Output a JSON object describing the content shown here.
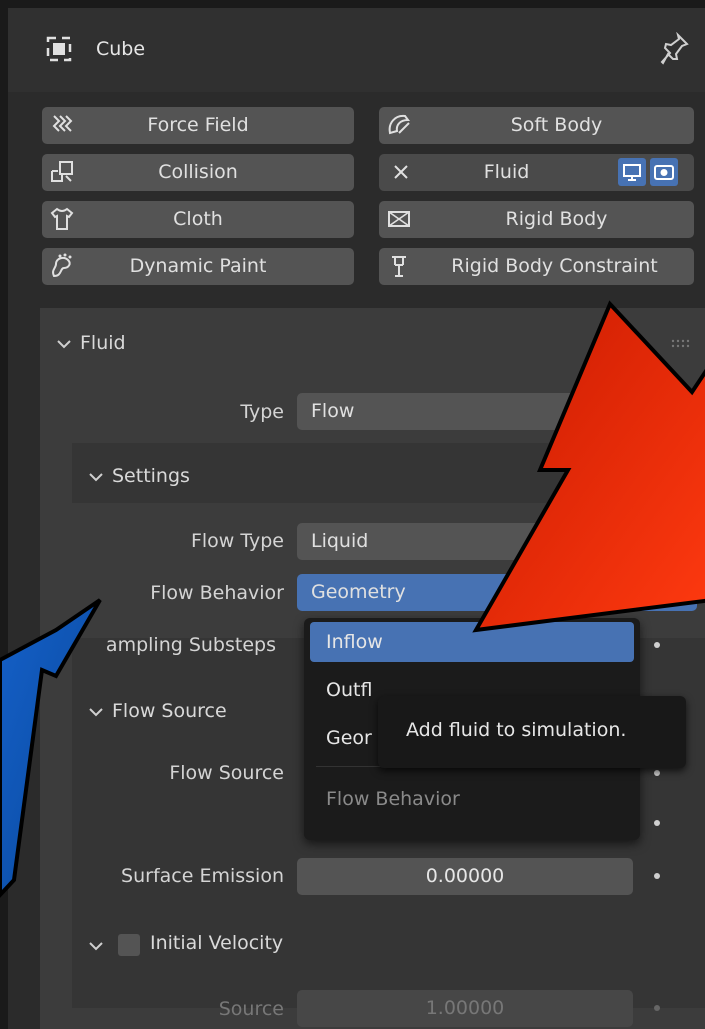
{
  "header": {
    "object_name": "Cube"
  },
  "physics_buttons": {
    "force_field": "Force Field",
    "soft_body": "Soft Body",
    "collision": "Collision",
    "fluid": "Fluid",
    "cloth": "Cloth",
    "rigid_body": "Rigid Body",
    "dynamic_paint": "Dynamic Paint",
    "rigid_body_constraint": "Rigid Body Constraint"
  },
  "fluid_panel": {
    "title": "Fluid",
    "type_label": "Type",
    "type_value": "Flow",
    "settings": {
      "title": "Settings",
      "flow_type_label": "Flow Type",
      "flow_type_value": "Liquid",
      "flow_behavior_label": "Flow Behavior",
      "flow_behavior_value": "Geometry",
      "sampling_label": "ampling Substeps"
    },
    "flow_source": {
      "title": "Flow Source",
      "flow_source_label": "Flow Source",
      "surface_emission_label": "Surface Emission",
      "surface_emission_value": "0.00000"
    },
    "initial_velocity": {
      "title": "Initial Velocity",
      "source_label": "Source",
      "source_value": "1.00000"
    }
  },
  "dropdown": {
    "items": [
      "Inflow",
      "Outfl",
      "Geor"
    ],
    "footer": "Flow Behavior"
  },
  "tooltip": {
    "text": "Add fluid to simulation."
  },
  "colors": {
    "accent": "#4772b3",
    "red_arrow": "#e8280a",
    "blue_arrow": "#0b5fbf"
  }
}
